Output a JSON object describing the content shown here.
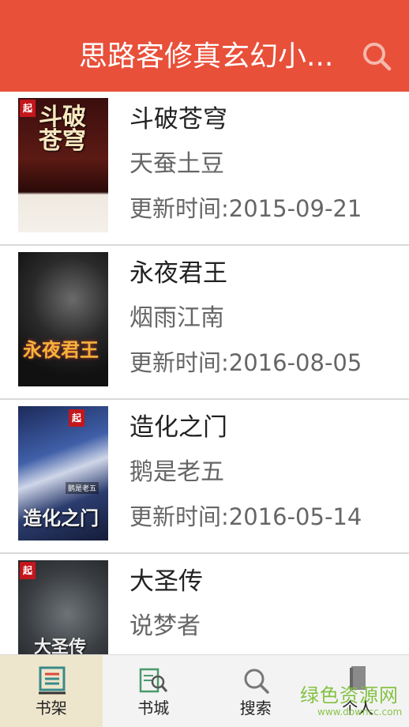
{
  "header": {
    "title": "思路客修真玄幻小...",
    "search_icon": "search-icon",
    "background": "#e8503a"
  },
  "books": [
    {
      "name": "斗破苍穹",
      "author": "天蚕土豆",
      "update": "更新时间:2015-09-21",
      "cover": {
        "title": "斗破苍穹",
        "badge": "起"
      }
    },
    {
      "name": "永夜君王",
      "author": "烟雨江南",
      "update": "更新时间:2016-08-05",
      "cover": {
        "title": "永夜君王"
      }
    },
    {
      "name": "造化之门",
      "author": "鹅是老五",
      "update": "更新时间:2016-05-14",
      "cover": {
        "title": "造化之门",
        "badge": "起",
        "author": "鹅是老五"
      }
    },
    {
      "name": "大圣传",
      "author": "说梦者",
      "update": "",
      "cover": {
        "title": "大圣传",
        "badge": "起"
      }
    }
  ],
  "tabs": [
    {
      "label": "书架",
      "icon": "bookshelf-icon",
      "active": true
    },
    {
      "label": "书城",
      "icon": "bookstore-icon",
      "active": false
    },
    {
      "label": "搜索",
      "icon": "search-icon",
      "active": false
    },
    {
      "label": "个人",
      "icon": "user-icon",
      "active": false
    }
  ],
  "watermark": {
    "main": "绿色资源网",
    "sub": "www.downcc.com"
  }
}
